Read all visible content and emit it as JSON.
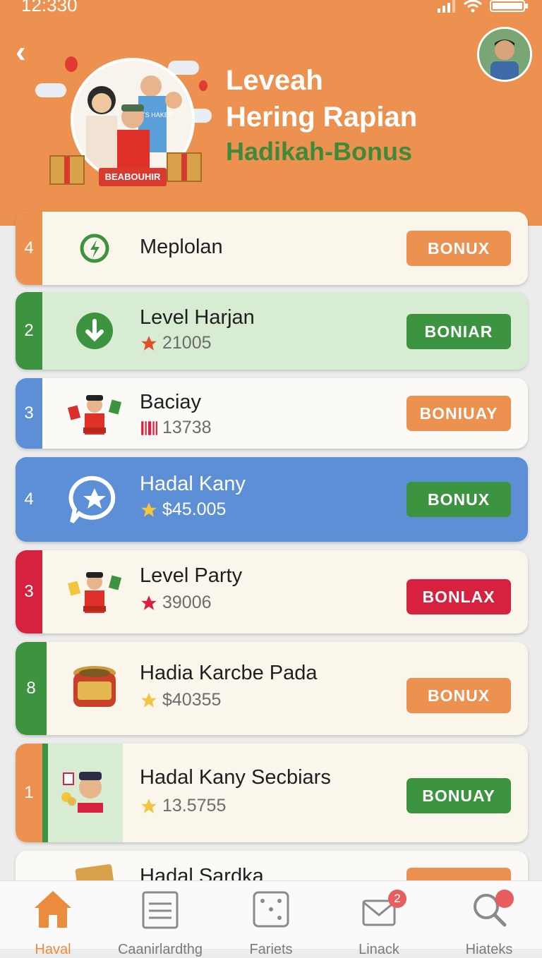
{
  "status_bar": {
    "time": "12:330"
  },
  "header": {
    "title_line1": "Leveah",
    "title_line2": "Hering Rapian",
    "subtitle": "Hadikah-Bonus",
    "hero_ribbon": "BEABOUHIR",
    "hero_shirt": "NOTS HAKER"
  },
  "colors": {
    "header": "#ec9150",
    "orange": "#ec9150",
    "green": "#3c9440",
    "blue": "#5c8fd6",
    "red": "#d6223f"
  },
  "levels": [
    {
      "number": "4",
      "name": "Meplolan",
      "value": "",
      "button": "BONUX",
      "accent": "orange",
      "icon": "lightning-badge-icon"
    },
    {
      "number": "2",
      "name": "Level Harjan",
      "value": "21005",
      "button": "BONIAR",
      "accent": "green",
      "icon": "download-badge-icon",
      "value_icon": "star-icon"
    },
    {
      "number": "3",
      "name": "Baciay",
      "value": "13738",
      "button": "BONIUAY",
      "accent": "blue",
      "icon": "boy-cards-icon",
      "value_icon": "barcode-icon"
    },
    {
      "number": "4",
      "name": "Hadal Kany",
      "value": "$45.005",
      "button": "BONUX",
      "accent": "blue",
      "icon": "star-chat-icon",
      "value_icon": "gold-star-icon"
    },
    {
      "number": "3",
      "name": "Level Party",
      "value": "39006",
      "button": "BONLAX",
      "accent": "red",
      "icon": "boy-cards-icon",
      "value_icon": "star-icon"
    },
    {
      "number": "8",
      "name": "Hadia Karcbe Pada",
      "value": "$40355",
      "button": "BONUX",
      "accent": "green",
      "icon": "treasure-jar-icon",
      "value_icon": "gold-star-icon"
    },
    {
      "number": "1",
      "name": "Hadal Kany Secbiars",
      "value": "13.5755",
      "button": "BONUAY",
      "accent": "orange",
      "icon": "boy-coins-icon",
      "value_icon": "gold-star-icon"
    },
    {
      "number": "",
      "name": "Hadal Sardka",
      "value": "",
      "button": "",
      "accent": "orange",
      "icon": "gold-bar-icon"
    }
  ],
  "nav": [
    {
      "label": "Haval",
      "icon": "home-icon",
      "active": true
    },
    {
      "label": "Caanirlardthg",
      "icon": "list-icon"
    },
    {
      "label": "Fariets",
      "icon": "dice-icon"
    },
    {
      "label": "Linack",
      "icon": "mail-icon",
      "badge": "2"
    },
    {
      "label": "Hiateks",
      "icon": "search-icon"
    }
  ]
}
